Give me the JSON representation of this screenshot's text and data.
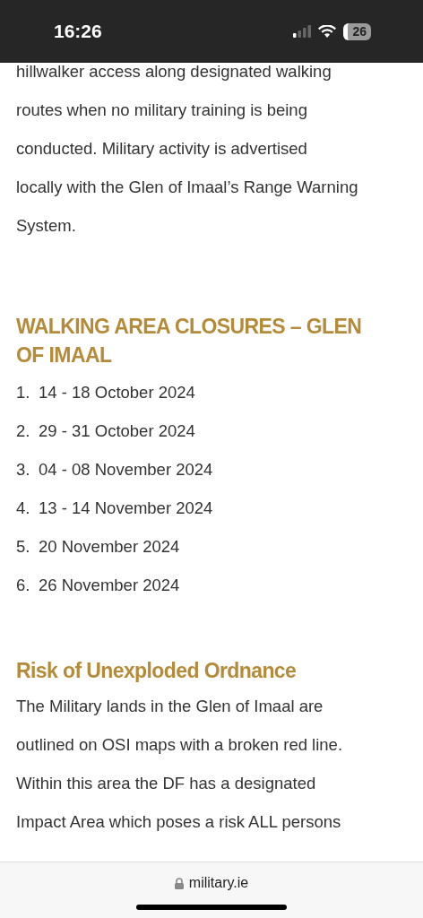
{
  "status_bar": {
    "time": "16:26",
    "battery": "26"
  },
  "intro": {
    "lines": [
      "hillwalker access along designated walking",
      "routes when no military training is being",
      "conducted. Military activity is advertised",
      "locally with the Glen of Imaal’s Range Warning",
      "System."
    ]
  },
  "closures": {
    "title_lines": [
      "WALKING AREA CLOSURES – GLEN",
      "OF IMAAL"
    ],
    "items": [
      {
        "number": "1.",
        "text": "14 - 18 October 2024"
      },
      {
        "number": "2.",
        "text": "29 - 31 October 2024"
      },
      {
        "number": "3.",
        "text": "04 - 08 November 2024"
      },
      {
        "number": "4.",
        "text": "13 - 14 November 2024"
      },
      {
        "number": "5.",
        "text": "20 November 2024"
      },
      {
        "number": "6.",
        "text": "26 November 2024"
      }
    ]
  },
  "ordnance": {
    "title": "Risk of Unexploded Ordnance",
    "lines": [
      "The Military lands in the Glen of Imaal are",
      "outlined on OSI maps with a broken red line.",
      "Within this area the DF has a designated",
      "Impact Area which poses a risk ALL persons"
    ]
  },
  "address_bar": {
    "url": "military.ie"
  }
}
